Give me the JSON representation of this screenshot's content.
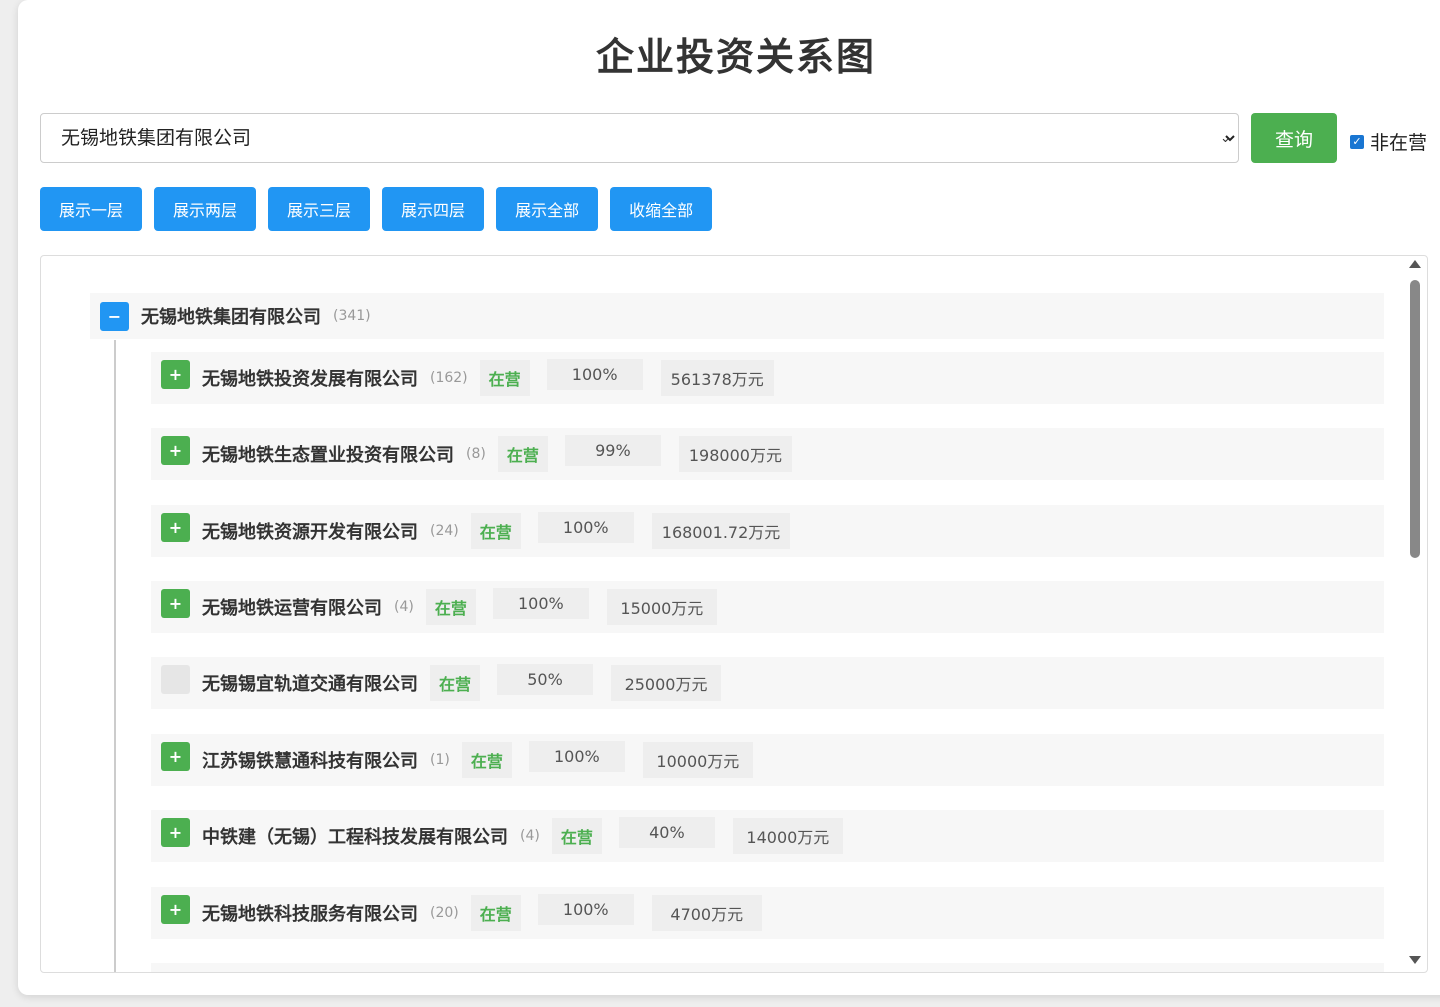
{
  "header": {
    "title": "企业投资关系图"
  },
  "search": {
    "selected_company": "无锡地铁集团有限公司",
    "query_label": "查询",
    "inactive_label": "非在营",
    "inactive_checked": true
  },
  "actions": {
    "items": [
      {
        "label": "展示一层"
      },
      {
        "label": "展示两层"
      },
      {
        "label": "展示三层"
      },
      {
        "label": "展示四层"
      },
      {
        "label": "展示全部"
      },
      {
        "label": "收缩全部"
      }
    ]
  },
  "tree": {
    "root": {
      "toggle": "−",
      "name": "无锡地铁集团有限公司",
      "count": "(341)"
    },
    "children": [
      {
        "toggle": "+",
        "name": "无锡地铁投资发展有限公司",
        "count": "(162)",
        "status": "在营",
        "percent": "100%",
        "amount": "561378万元"
      },
      {
        "toggle": "+",
        "name": "无锡地铁生态置业投资有限公司",
        "count": "(8)",
        "status": "在营",
        "percent": "99%",
        "amount": "198000万元"
      },
      {
        "toggle": "+",
        "name": "无锡地铁资源开发有限公司",
        "count": "(24)",
        "status": "在营",
        "percent": "100%",
        "amount": "168001.72万元"
      },
      {
        "toggle": "+",
        "name": "无锡地铁运营有限公司",
        "count": "(4)",
        "status": "在营",
        "percent": "100%",
        "amount": "15000万元"
      },
      {
        "toggle": "",
        "name": "无锡锡宜轨道交通有限公司",
        "count": "",
        "status": "在营",
        "percent": "50%",
        "amount": "25000万元"
      },
      {
        "toggle": "+",
        "name": "江苏锡铁慧通科技有限公司",
        "count": "(1)",
        "status": "在营",
        "percent": "100%",
        "amount": "10000万元"
      },
      {
        "toggle": "+",
        "name": "中铁建（无锡）工程科技发展有限公司",
        "count": "(4)",
        "status": "在营",
        "percent": "40%",
        "amount": "14000万元"
      },
      {
        "toggle": "+",
        "name": "无锡地铁科技服务有限公司",
        "count": "(20)",
        "status": "在营",
        "percent": "100%",
        "amount": "4700万元"
      }
    ]
  },
  "colors": {
    "primary": "#2196f3",
    "success": "#4caf50",
    "disabled": "#e6e6e6"
  }
}
